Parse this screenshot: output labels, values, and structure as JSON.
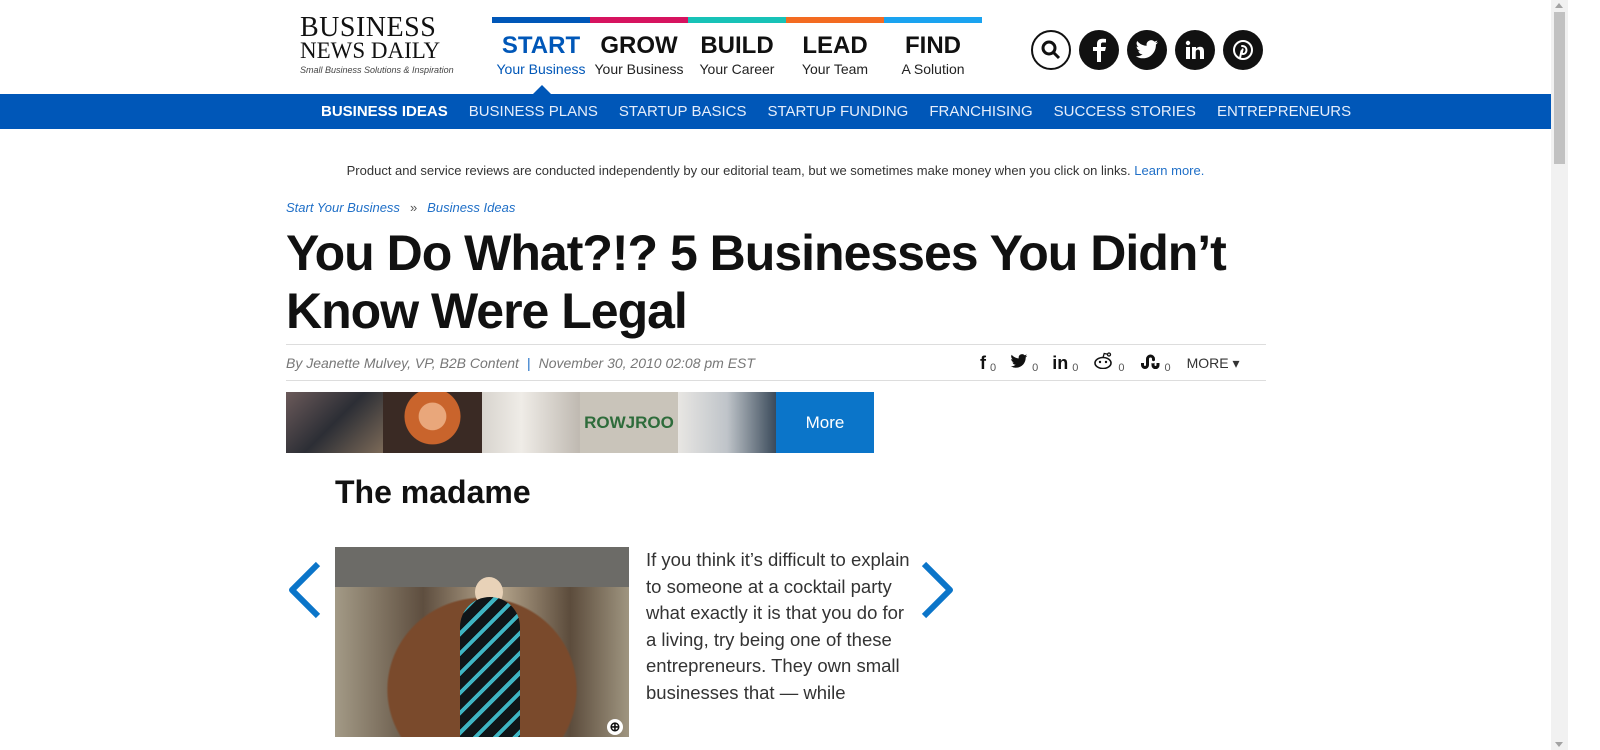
{
  "logo": {
    "line1": "BUSINESS",
    "line2": "NEWS DAILY",
    "tagline": "Small Business Solutions & Inspiration"
  },
  "topnav": [
    {
      "big": "START",
      "small": "Your Business",
      "color": "#0057b8",
      "active": true
    },
    {
      "big": "GROW",
      "small": "Your Business",
      "color": "#d6135f"
    },
    {
      "big": "BUILD",
      "small": "Your Career",
      "color": "#17c2b7"
    },
    {
      "big": "LEAD",
      "small": "Your Team",
      "color": "#f36b21"
    },
    {
      "big": "FIND",
      "small": "A Solution",
      "color": "#1aa3f0"
    }
  ],
  "social_icons": [
    "search-icon",
    "facebook-icon",
    "twitter-icon",
    "linkedin-icon",
    "pinterest-icon"
  ],
  "subnav": [
    "BUSINESS IDEAS",
    "BUSINESS PLANS",
    "STARTUP BASICS",
    "STARTUP FUNDING",
    "FRANCHISING",
    "SUCCESS STORIES",
    "ENTREPRENEURS"
  ],
  "disclaimer": {
    "text": "Product and service reviews are conducted independently by our editorial team, but we sometimes make money when you click on links.",
    "link": "Learn more."
  },
  "breadcrumb": {
    "first": "Start Your Business",
    "sep": "»",
    "second": "Business Ideas"
  },
  "headline": "You Do What?!? 5 Businesses You Didn’t Know Were Legal",
  "byline": {
    "author": "By Jeanette Mulvey, VP, B2B Content",
    "sep": "|",
    "date": "November 30, 2010 02:08 pm EST"
  },
  "share": {
    "items": [
      {
        "glyph": "f",
        "count": "0",
        "icon": "facebook-icon"
      },
      {
        "glyph": "🐦",
        "count": "0",
        "icon": "twitter-icon"
      },
      {
        "glyph": "in",
        "count": "0",
        "icon": "linkedin-icon"
      },
      {
        "glyph": "👽",
        "count": "0",
        "icon": "reddit-icon"
      },
      {
        "glyph": "S",
        "count": "0",
        "icon": "stumbleupon-icon"
      }
    ],
    "more": "MORE ▾"
  },
  "thumbnail_strip": {
    "logo_text": "ROWJROO",
    "more_label": "More"
  },
  "slide": {
    "title": "The madame",
    "text": "If you think it’s difficult to explain to someone at a cocktail party what exactly it is that you do for a living, try being one of these entrepreneurs. They own small businesses that — while"
  }
}
